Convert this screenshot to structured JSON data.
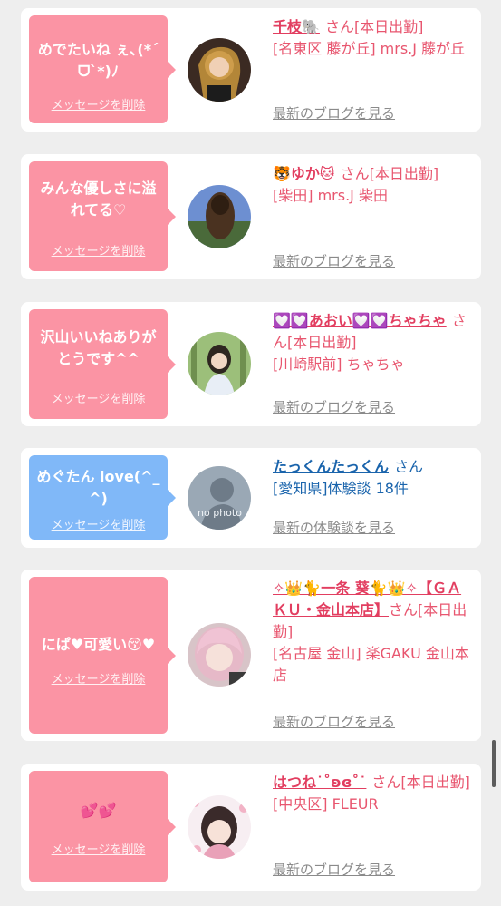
{
  "colors": {
    "bubble_pink": "#fb94a4",
    "bubble_blue": "#80b8f8",
    "name_pink": "#e23e60",
    "name_blue": "#1a64ac",
    "link_gray": "#8a8a8a",
    "page_bg": "#eeeeee",
    "card_bg": "#ffffff"
  },
  "delete_label": "メッセージを削除",
  "entries": [
    {
      "message": "めでたいね ぇ､(*ˊᗜˋ*)ﾉ",
      "avatar": "user-avatar",
      "name": "千枝🐘",
      "suffix": "さん[本日出勤]",
      "area": "[名東区 藤が丘] mrs.J 藤が丘",
      "link": "最新のブログを見る"
    },
    {
      "message": "みんな優しさに溢れてる♡",
      "avatar": "user-avatar",
      "name": "🐯ゆか🐱",
      "suffix": "さん[本日出勤]",
      "area": "[柴田] mrs.J 柴田",
      "link": "最新のブログを見る"
    },
    {
      "message": "沢山いいねありがとうです^^",
      "avatar": "user-avatar",
      "name": "💟💟あおい💟💟ちゃちゃ",
      "suffix": "さん[本日出勤]",
      "area": "[川崎駅前] ちゃちゃ",
      "link": "最新のブログを見る"
    },
    {
      "message": "めぐたん love(^_^)",
      "avatar": "no-photo-avatar",
      "avatar_text": "no photo",
      "name": "たっくんたっくん",
      "suffix": "さん",
      "area": "[愛知県]体験談 18件",
      "link": "最新の体験談を見る"
    },
    {
      "message": "にぱ♥可愛い😚♥",
      "avatar": "user-avatar",
      "name": "✧👑🐈一条 葵🐈👑✧【ＧＡＫＵ・金山本店】",
      "suffix": "さん[本日出勤]",
      "area": "[名古屋 金山] 楽GAKU 金山本店",
      "link": "最新のブログを見る"
    },
    {
      "message": "💕💕",
      "avatar": "user-avatar",
      "name": "はつね˙˚ʚɞ˚˙",
      "suffix": "さん[本日出勤]",
      "area": "[中央区] FLEUR",
      "link": "最新のブログを見る"
    }
  ]
}
